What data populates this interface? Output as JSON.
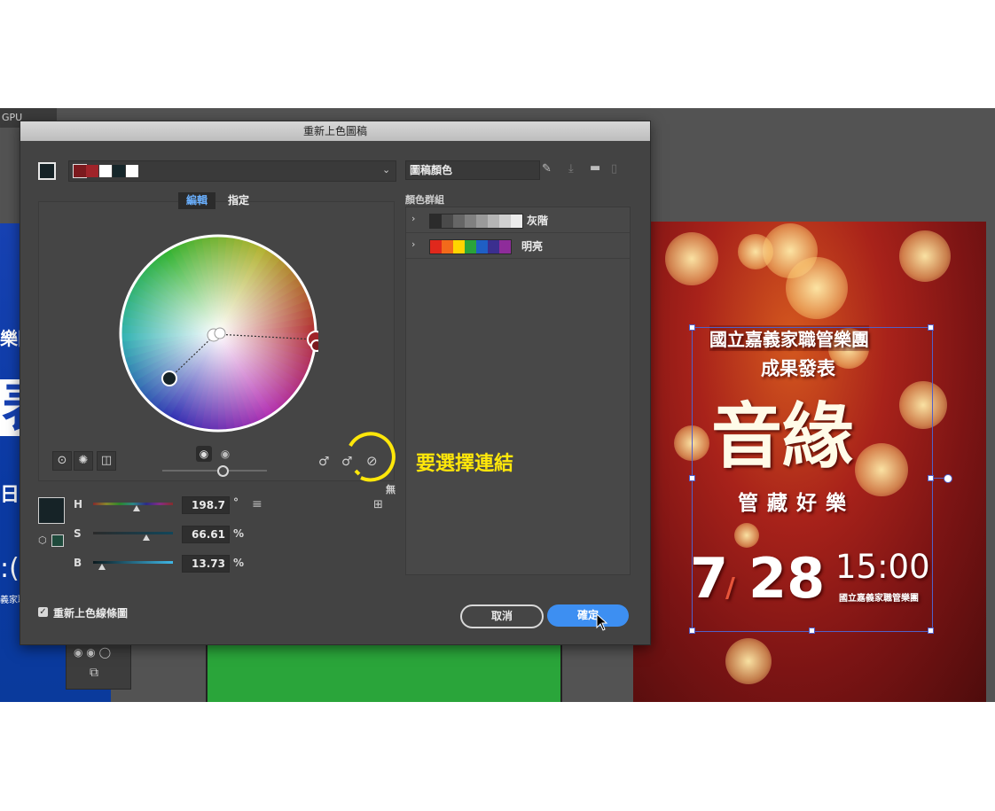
{
  "app": {
    "gpu_tab": "GPU"
  },
  "dialog": {
    "title": "重新上色圖稿",
    "colors": {
      "current": "#162327",
      "swatches": [
        "#7b1a1e",
        "#a0242a",
        "#ffffff",
        "#15262a",
        "#ffffff"
      ]
    },
    "tabs": {
      "edit": "編輯",
      "assign": "指定"
    },
    "hsb": {
      "h_label": "H",
      "h_value": "198.7",
      "h_unit": "°",
      "h_fraction": 0.55,
      "s_label": "S",
      "s_value": "66.61",
      "s_unit": "%",
      "s_fraction": 0.67,
      "b_label": "B",
      "b_value": "13.73",
      "b_unit": "%",
      "b_fraction": 0.14
    },
    "link_state": "無",
    "recolor_label": "重新上色線條圖",
    "cancel_label": "取消",
    "ok_label": "確定",
    "artwork_colors_field": "圖稿顏色",
    "groups_label": "顏色群組",
    "groups": [
      {
        "name": "灰階",
        "colors": [
          "#2b2b2b",
          "#4a4a4a",
          "#666666",
          "#808080",
          "#9a9a9a",
          "#b5b5b5",
          "#d0d0d0",
          "#ececec"
        ]
      },
      {
        "name": "明亮",
        "colors": [
          "#e0281c",
          "#f26a1b",
          "#ffd400",
          "#2aa33a",
          "#1f5fc4",
          "#3b2f8f",
          "#8e2c9a"
        ]
      }
    ],
    "icons": {
      "current_color": "square-icon",
      "dropdown": "chevron-down-icon",
      "eyedropper": "eyedropper-icon",
      "save_group": "save-group-icon",
      "folder": "folder-icon",
      "trash": "trash-icon",
      "smooth_wheel": "smooth-wheel-icon",
      "segmented_wheel": "segmented-wheel-icon",
      "color_bars": "color-bars-icon",
      "add_color": "add-color-icon",
      "remove_color": "remove-color-icon",
      "unlink_harmony": "unlink-icon",
      "menu": "menu-icon",
      "grid": "grid-icon",
      "gamut": "cube-icon",
      "cursor": "cursor-icon"
    }
  },
  "annotation": {
    "text": "要選擇連結",
    "color": "#ffe70a"
  },
  "poster": {
    "line1": "國立嘉義家職管樂團",
    "line2": "成果發表",
    "title": "音緣",
    "subtitle": [
      "管",
      "藏",
      "好",
      "樂"
    ],
    "date_month": "7",
    "date_day": "28",
    "time": "15:00",
    "org": "國立嘉義家職管樂團"
  },
  "left_art": {
    "chars": [
      "樂團",
      "表",
      "日.",
      ":(",
      "義家職"
    ]
  }
}
